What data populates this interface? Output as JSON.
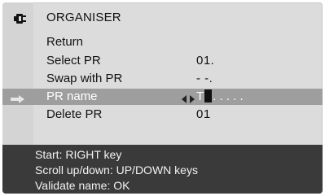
{
  "menu": {
    "title": "ORGANISER",
    "icon": "organiser-plug-icon"
  },
  "items": [
    {
      "label": "Return",
      "value": ""
    },
    {
      "label": "Select PR",
      "value": "01."
    },
    {
      "label": "Swap with PR",
      "value": "- -."
    },
    {
      "label": "PR name",
      "value": "T.....",
      "selected": true
    },
    {
      "label": "Delete PR",
      "value": "01"
    }
  ],
  "name_editor": {
    "first_char": "T",
    "rest": ". . . . ."
  },
  "help": {
    "line1": "Start: RIGHT key",
    "line2": "Scroll up/down: UP/DOWN keys",
    "line3": "Validate name: OK"
  },
  "colors": {
    "panel": "#dcdcdc",
    "selection": "#9e9e9e",
    "help_bar": "#3a3a3a",
    "text": "#111111"
  }
}
